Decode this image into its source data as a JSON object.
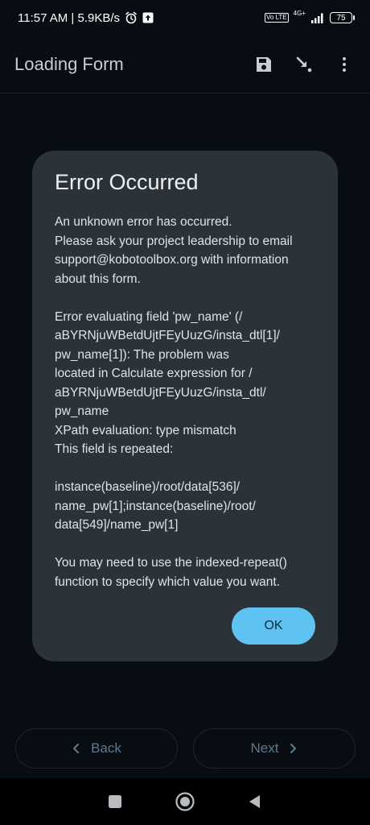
{
  "status_bar": {
    "time_speed": "11:57 AM | 5.9KB/s",
    "volte": "Vo LTE",
    "network": "4G+",
    "battery": "75"
  },
  "app_bar": {
    "title": "Loading Form"
  },
  "dialog": {
    "title": "Error Occurred",
    "body": "An unknown error has occurred.\nPlease ask your project leadership to email support@kobotoolbox.org with information about this form.\n\nError evaluating field 'pw_name' (/\naBYRNjuWBetdUjtFEyUuzG/insta_dtl[1]/\npw_name[1]): The problem was\nlocated in Calculate expression for /\naBYRNjuWBetdUjtFEyUuzG/insta_dtl/\npw_name\nXPath evaluation: type mismatch\nThis field is repeated:\n\ninstance(baseline)/root/data[536]/\nname_pw[1];instance(baseline)/root/\ndata[549]/name_pw[1]\n\nYou may need to use the indexed-repeat()\nfunction to specify which value you want.",
    "ok_label": "OK"
  },
  "navigation": {
    "back_label": "Back",
    "next_label": "Next"
  },
  "colors": {
    "background": "#070d12",
    "dialog": "#2c3338",
    "accent": "#5ec3f2",
    "nav_text": "#5c7b92"
  },
  "icons": {
    "alarm": "alarm-icon",
    "upload": "upload-icon",
    "signal": "signal-icon",
    "save": "save-icon",
    "go_to": "go-to-icon",
    "more": "more-vert-icon",
    "chevron_left": "chevron-left-icon",
    "chevron_right": "chevron-right-icon",
    "recents": "recents-square-icon",
    "home": "home-circle-icon",
    "back": "back-triangle-icon"
  }
}
